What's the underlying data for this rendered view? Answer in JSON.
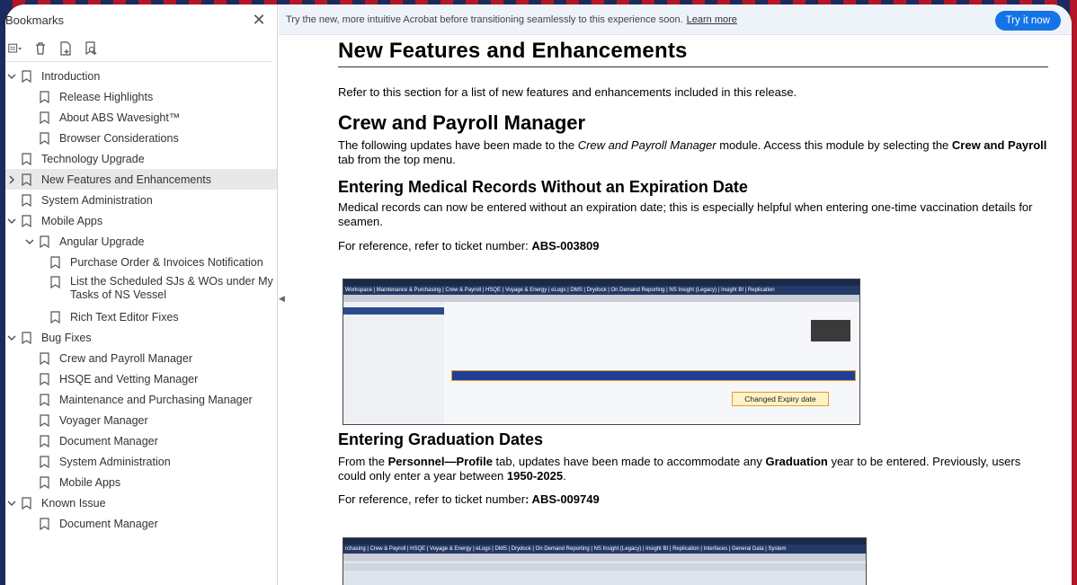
{
  "sidebar": {
    "title": "Bookmarks",
    "items": [
      {
        "label": "Introduction",
        "level": 0,
        "chevron": "down"
      },
      {
        "label": "Release Highlights",
        "level": 1
      },
      {
        "label": "About ABS Wavesight™",
        "level": 1
      },
      {
        "label": "Browser Considerations",
        "level": 1
      },
      {
        "label": "Technology Upgrade",
        "level": 0
      },
      {
        "label": "New Features and Enhancements",
        "level": 0,
        "chevron": "right",
        "selected": true
      },
      {
        "label": "System Administration",
        "level": 0
      },
      {
        "label": "Mobile Apps",
        "level": 0,
        "chevron": "down"
      },
      {
        "label": "Angular Upgrade",
        "level": 1,
        "chevron": "down"
      },
      {
        "label": "Purchase Order & Invoices Notification",
        "level": 2
      },
      {
        "label": "List the Scheduled SJs & WOs under My Tasks of NS Vessel",
        "level": 2
      },
      {
        "label": "Rich Text Editor Fixes",
        "level": 2
      },
      {
        "label": "Bug Fixes",
        "level": 0,
        "chevron": "down"
      },
      {
        "label": "Crew and Payroll Manager",
        "level": 1
      },
      {
        "label": "HSQE and Vetting Manager",
        "level": 1
      },
      {
        "label": "Maintenance and Purchasing Manager",
        "level": 1
      },
      {
        "label": "Voyager Manager",
        "level": 1
      },
      {
        "label": "Document Manager",
        "level": 1
      },
      {
        "label": "System Administration",
        "level": 1
      },
      {
        "label": "Mobile Apps",
        "level": 1
      },
      {
        "label": "Known Issue",
        "level": 0,
        "chevron": "down"
      },
      {
        "label": "Document Manager",
        "level": 1
      }
    ]
  },
  "banner": {
    "text": "Try the new, more intuitive Acrobat before transitioning seamlessly to this experience soon.",
    "link": "Learn more",
    "button": "Try it now"
  },
  "doc": {
    "h1": "New Features and Enhancements",
    "intro": "Refer to this section for a list of new features and enhancements included in this release.",
    "h2": "Crew and Payroll Manager",
    "p1_a": "The following updates have been made to the ",
    "p1_em": "Crew and Payroll Manager",
    "p1_b": " module. Access this module by selecting the ",
    "p1_strong": "Crew and Payroll",
    "p1_c": " tab from the top menu.",
    "h3a": "Entering Medical Records Without an Expiration Date",
    "p2": "Medical records can now be entered without an expiration date; this is especially helpful when entering one-time vaccination details for seamen.",
    "ref1_label": "For reference, refer to ticket number: ",
    "ref1_ticket": "ABS-003809",
    "callout": "Changed Expiry date",
    "h3b": "Entering Graduation Dates",
    "p3_a": "From the ",
    "p3_s1": "Personnel—Profile",
    "p3_b": " tab, updates have been made to accommodate any ",
    "p3_s2": "Graduation",
    "p3_c": " year to be entered. Previously, users could only enter a year between ",
    "p3_s3": "1950-2025",
    "p3_d": ".",
    "ref2_label": "For reference, refer to ticket number",
    "ref2_ticket": ": ABS-009749",
    "shot1_nav": "Workspace | Maintenance & Purchasing | Crew & Payroll | HSQE | Voyage & Energy | eLogs | DMS | Drydock | On Demand Reporting | NS Insight (Legacy) | Insight BI | Replication",
    "shot2_nav": "rchasing | Crew & Payroll | HSQE | Voyage & Energy | eLogs | DMS | Drydock | On Demand Reporting | NS Insight (Legacy) | Insight BI | Replication | Interfaces | General Data | System"
  }
}
